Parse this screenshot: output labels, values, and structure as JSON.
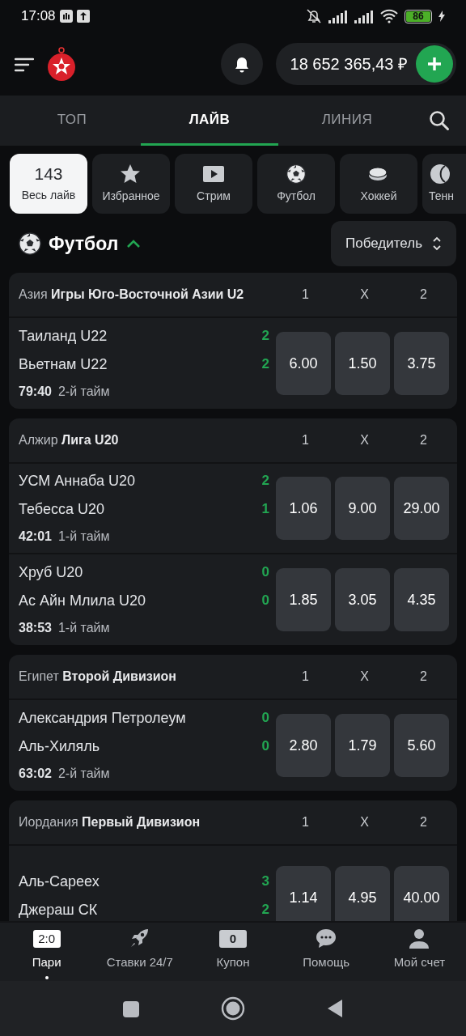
{
  "status_bar": {
    "time": "17:08",
    "battery": "86"
  },
  "header": {
    "balance": "18 652 365,43 ₽"
  },
  "tabs": [
    {
      "label": "ТОП",
      "selected": false
    },
    {
      "label": "ЛАЙВ",
      "selected": true
    },
    {
      "label": "ЛИНИЯ",
      "selected": false
    }
  ],
  "filters": [
    {
      "kind": "count",
      "count": "143",
      "label": "Весь лайв",
      "selected": true
    },
    {
      "kind": "star",
      "label": "Избранное",
      "selected": false
    },
    {
      "kind": "stream",
      "label": "Стрим",
      "selected": false
    },
    {
      "kind": "football",
      "label": "Футбол",
      "selected": false
    },
    {
      "kind": "hockey",
      "label": "Хоккей",
      "selected": false
    },
    {
      "kind": "tennis",
      "label": "Тенн",
      "selected": false
    }
  ],
  "section": {
    "title": "Футбол",
    "expanded": true,
    "market": "Победитель"
  },
  "leagues": [
    {
      "region": "Азия",
      "name": "Игры Юго-Восточной Азии U2",
      "columns": [
        "1",
        "X",
        "2"
      ],
      "matches": [
        {
          "team_1": "Таиланд U22",
          "team_2": "Вьетнам U22",
          "score_1": "2",
          "score_2": "2",
          "clock": "79:40",
          "period": "2-й тайм",
          "odds": [
            "6.00",
            "1.50",
            "3.75"
          ]
        }
      ]
    },
    {
      "region": "Алжир",
      "name": "Лига U20",
      "columns": [
        "1",
        "X",
        "2"
      ],
      "matches": [
        {
          "team_1": "УСМ Аннаба U20",
          "team_2": "Тебесса U20",
          "score_1": "2",
          "score_2": "1",
          "clock": "42:01",
          "period": "1-й тайм",
          "odds": [
            "1.06",
            "9.00",
            "29.00"
          ]
        },
        {
          "team_1": "Хруб U20",
          "team_2": "Ас Айн Млила U20",
          "score_1": "0",
          "score_2": "0",
          "clock": "38:53",
          "period": "1-й тайм",
          "odds": [
            "1.85",
            "3.05",
            "4.35"
          ]
        }
      ]
    },
    {
      "region": "Египет",
      "name": "Второй Дивизион",
      "columns": [
        "1",
        "X",
        "2"
      ],
      "matches": [
        {
          "team_1": "Александрия Петролеум",
          "team_2": "Аль-Хиляль",
          "score_1": "0",
          "score_2": "0",
          "clock": "63:02",
          "period": "2-й тайм",
          "odds": [
            "2.80",
            "1.79",
            "5.60"
          ]
        }
      ]
    },
    {
      "region": "Иордания",
      "name": "Первый Дивизион",
      "columns": [
        "1",
        "X",
        "2"
      ],
      "matches": [
        {
          "team_1": "Аль-Сареех",
          "team_2": "Джераш СК",
          "score_1": "3",
          "score_2": "2",
          "odds": [
            "1.14",
            "4.95",
            "40.00"
          ]
        }
      ]
    }
  ],
  "bottom_nav": [
    {
      "kind": "score",
      "badge": "2:0",
      "label": "Пари",
      "selected": true
    },
    {
      "kind": "rocket",
      "label": "Ставки 24/7",
      "selected": false
    },
    {
      "kind": "coupon",
      "badge": "0",
      "label": "Купон",
      "selected": false
    },
    {
      "kind": "chat",
      "label": "Помощь",
      "selected": false
    },
    {
      "kind": "person",
      "label": "Мой счет",
      "selected": false
    }
  ]
}
